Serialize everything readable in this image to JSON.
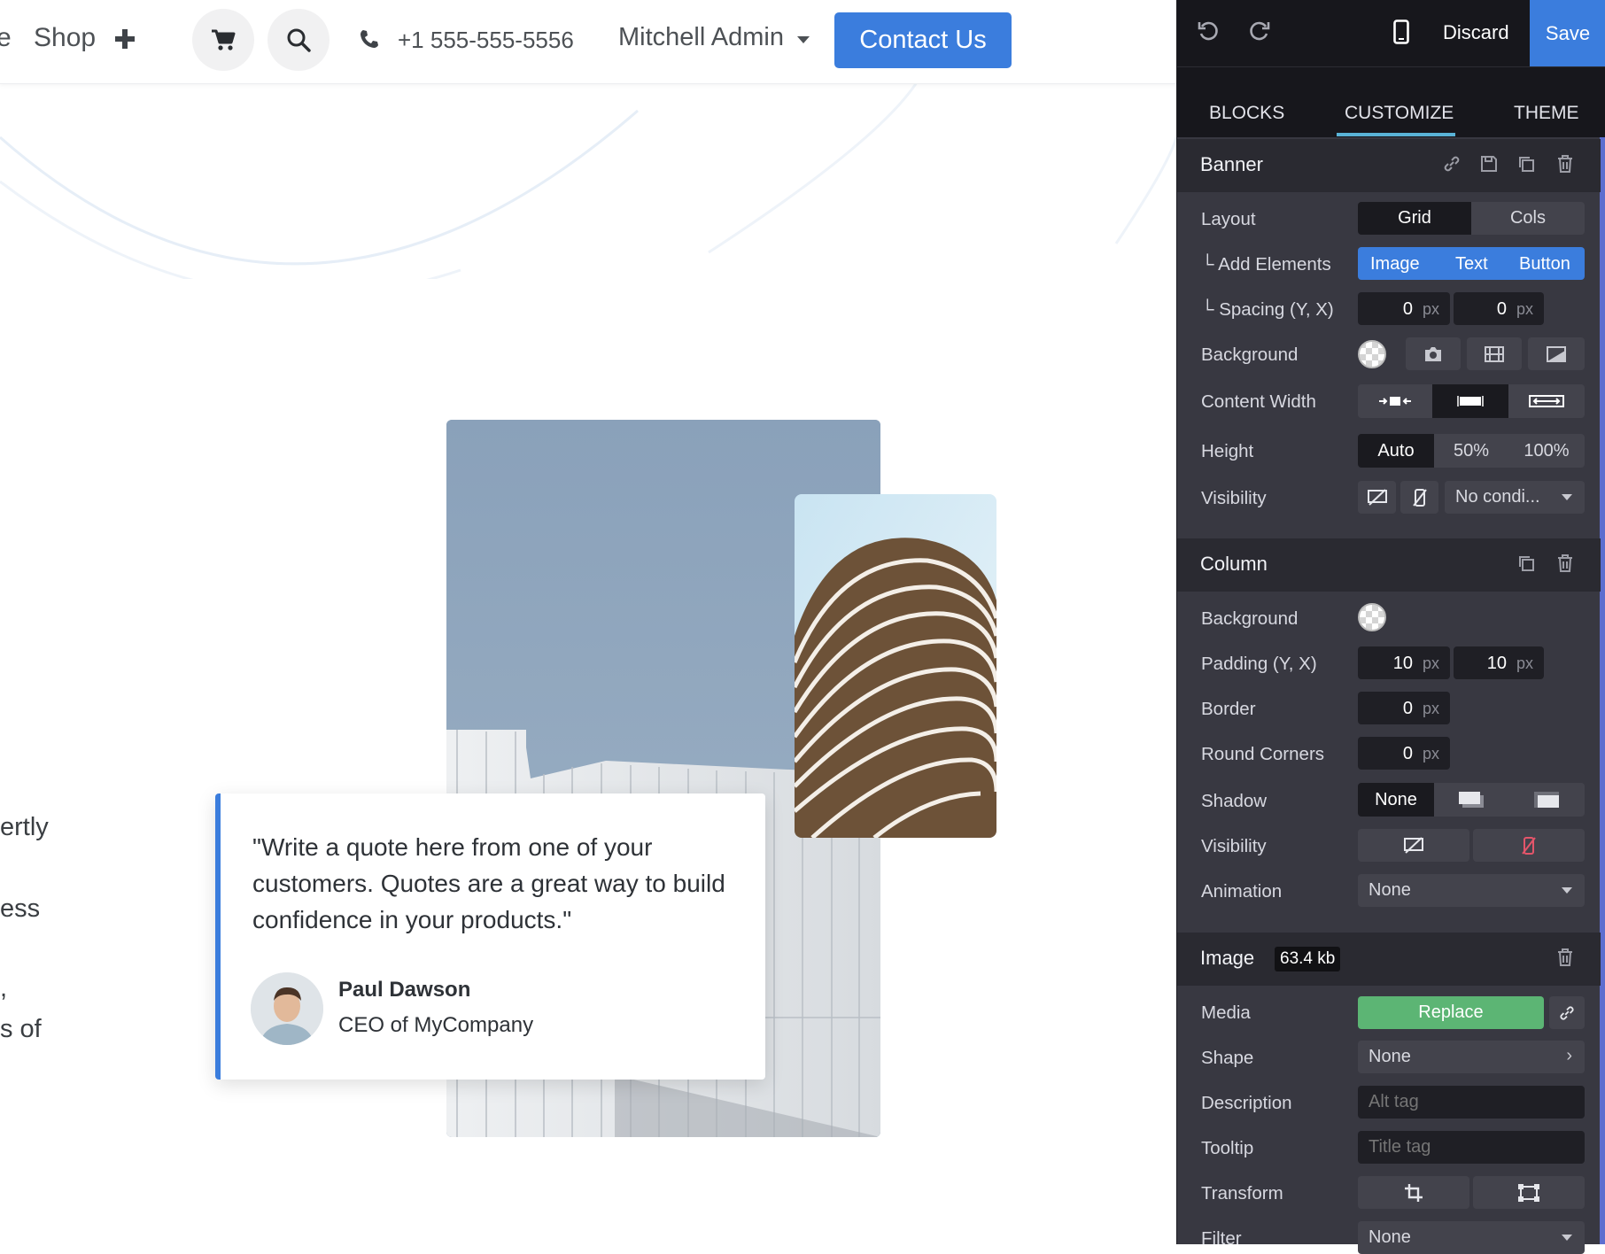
{
  "navbar": {
    "fragment_left": "e",
    "shop_label": "Shop",
    "phone": "+1 555-555-5556",
    "user_menu": "Mitchell Admin",
    "contact_button": "Contact Us"
  },
  "hero": {
    "left_fragments": [
      "ertly",
      "ess",
      ",",
      "s of"
    ],
    "quote": {
      "text": "\"Write a quote here from one of your customers. Quotes are a great way to build confidence in your products.\"",
      "author": "Paul Dawson",
      "role": "CEO of MyCompany"
    }
  },
  "editor": {
    "toolbar": {
      "discard": "Discard",
      "save": "Save"
    },
    "tabs": [
      "BLOCKS",
      "CUSTOMIZE",
      "THEME"
    ],
    "active_tab": "CUSTOMIZE",
    "banner": {
      "title": "Banner",
      "layout": {
        "label": "Layout",
        "options": [
          "Grid",
          "Cols"
        ],
        "selected": "Grid"
      },
      "add_elements": {
        "label": "└ Add Elements",
        "options": [
          "Image",
          "Text",
          "Button"
        ]
      },
      "spacing": {
        "label": "└ Spacing (Y, X)",
        "y": "0",
        "x": "0",
        "unit": "px"
      },
      "background": {
        "label": "Background"
      },
      "content_width": {
        "label": "Content Width"
      },
      "height": {
        "label": "Height",
        "options": [
          "Auto",
          "50%",
          "100%"
        ],
        "selected": "Auto"
      },
      "visibility": {
        "label": "Visibility",
        "select": "No condi..."
      }
    },
    "column": {
      "title": "Column",
      "background": {
        "label": "Background"
      },
      "padding": {
        "label": "Padding (Y, X)",
        "y": "10",
        "x": "10",
        "unit": "px"
      },
      "border": {
        "label": "Border",
        "value": "0",
        "unit": "px"
      },
      "round_corners": {
        "label": "Round Corners",
        "value": "0",
        "unit": "px"
      },
      "shadow": {
        "label": "Shadow",
        "selected": "None"
      },
      "visibility": {
        "label": "Visibility"
      },
      "animation": {
        "label": "Animation",
        "value": "None"
      }
    },
    "image": {
      "title": "Image",
      "size_badge": "63.4 kb",
      "media": {
        "label": "Media",
        "button": "Replace"
      },
      "shape": {
        "label": "Shape",
        "value": "None"
      },
      "description": {
        "label": "Description",
        "placeholder": "Alt tag"
      },
      "tooltip": {
        "label": "Tooltip",
        "placeholder": "Title tag"
      },
      "transform": {
        "label": "Transform"
      },
      "filter": {
        "label": "Filter",
        "value": "None"
      }
    }
  },
  "colors": {
    "accent": "#3b7ddd",
    "replace_green": "#5cb574",
    "panel_bg": "#383841",
    "panel_dark": "#17171c"
  }
}
